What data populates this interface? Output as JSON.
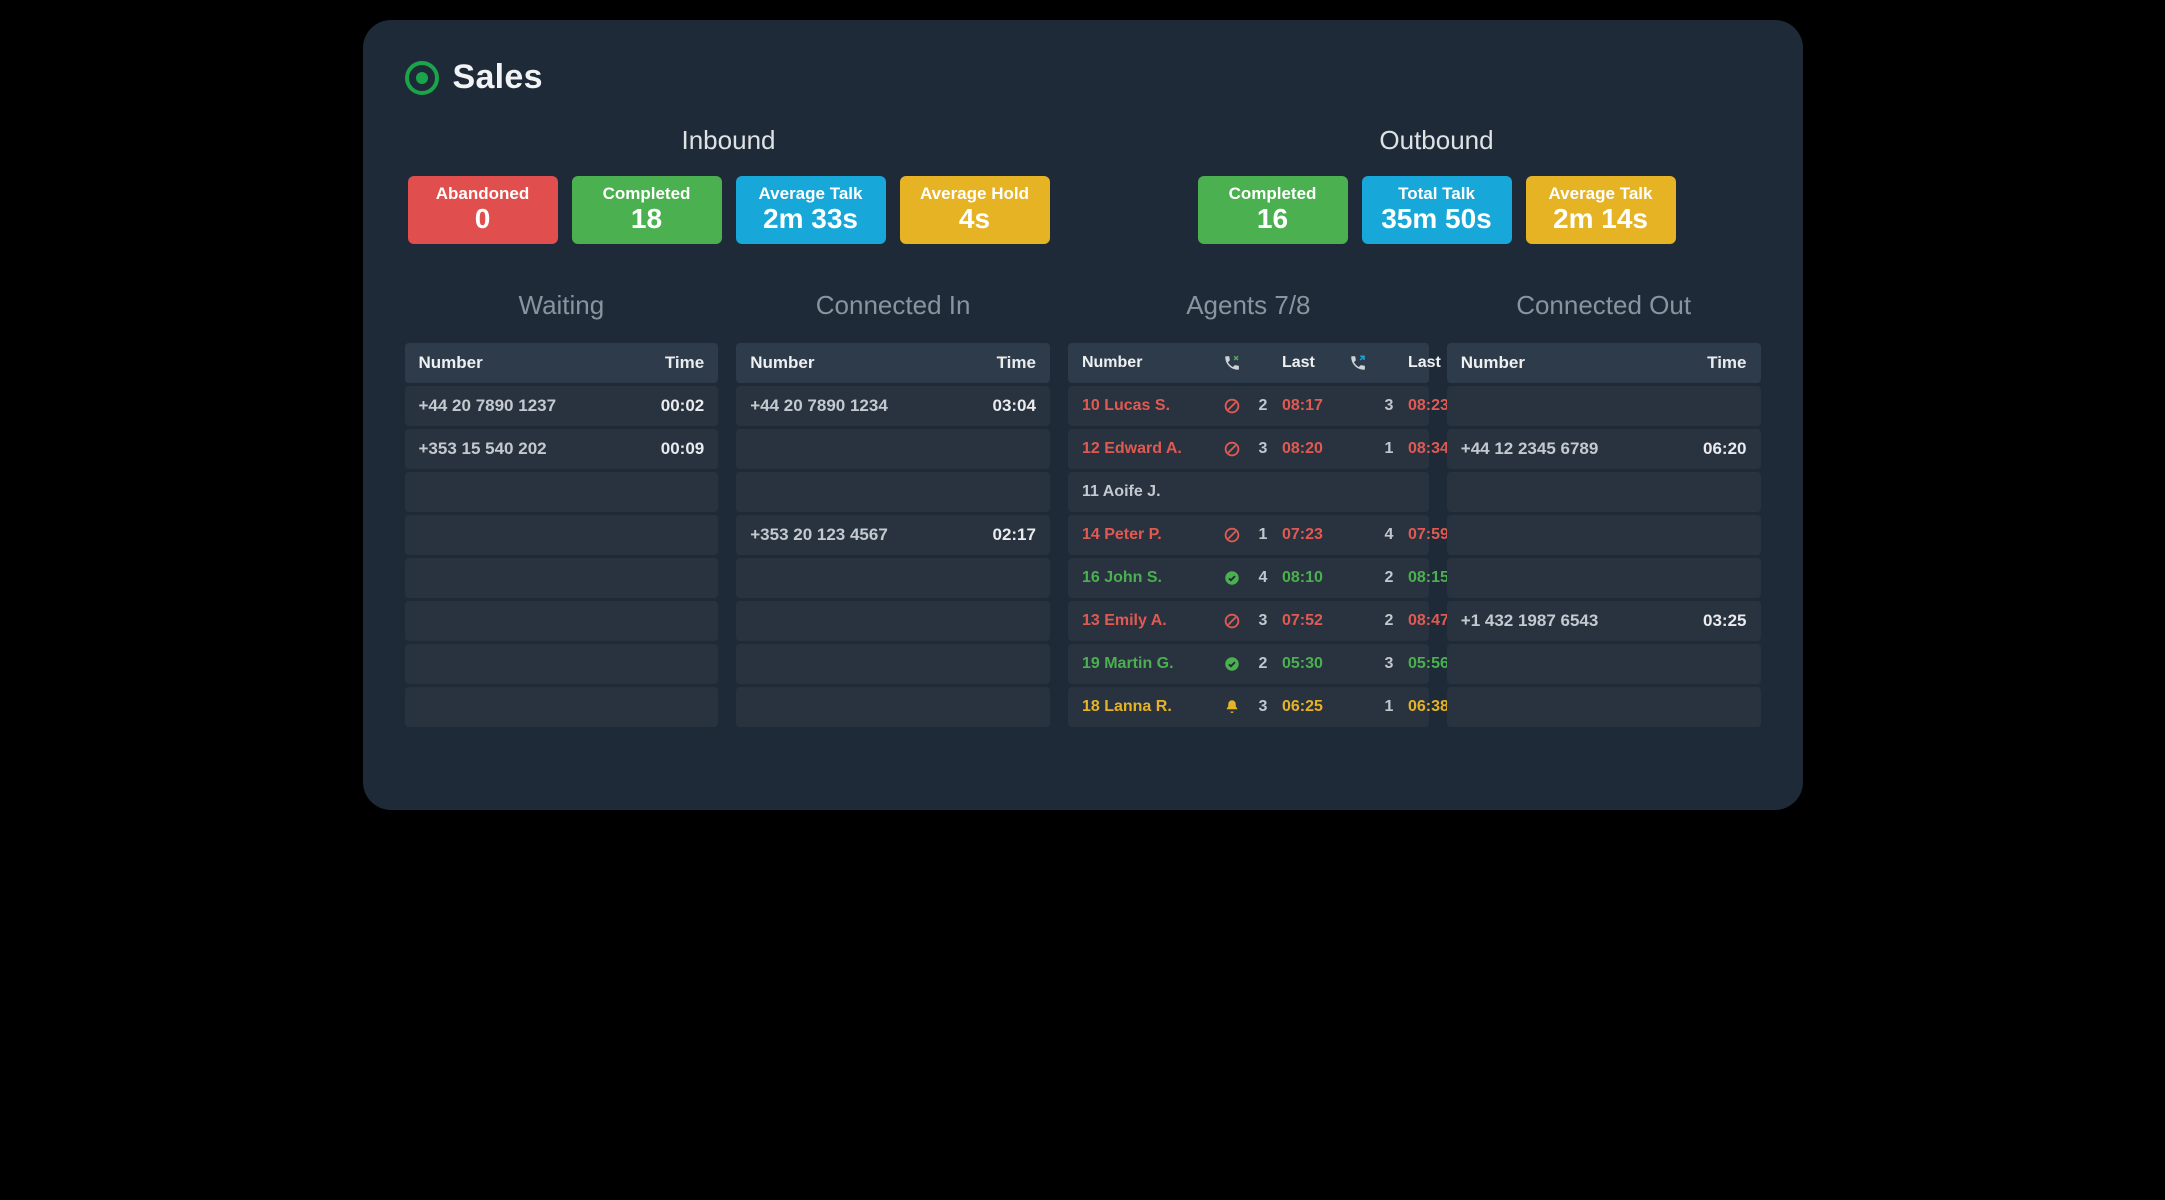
{
  "page": {
    "title": "Sales",
    "status": "online"
  },
  "metric_groups": [
    {
      "title": "Inbound",
      "cards": [
        {
          "label": "Abandoned",
          "value": "0",
          "color": "red"
        },
        {
          "label": "Completed",
          "value": "18",
          "color": "green"
        },
        {
          "label": "Average Talk",
          "value": "2m 33s",
          "color": "blue"
        },
        {
          "label": "Average Hold",
          "value": "4s",
          "color": "yellow"
        }
      ]
    },
    {
      "title": "Outbound",
      "cards": [
        {
          "label": "Completed",
          "value": "16",
          "color": "green"
        },
        {
          "label": "Total Talk",
          "value": "35m 50s",
          "color": "blue"
        },
        {
          "label": "Average Talk",
          "value": "2m 14s",
          "color": "yellow"
        }
      ]
    }
  ],
  "columns": {
    "waiting": {
      "title": "Waiting",
      "headers": {
        "number": "Number",
        "time": "Time"
      },
      "rows": [
        {
          "number": "+44 20 7890 1237",
          "time": "00:02"
        },
        {
          "number": "+353 15 540 202",
          "time": "00:09"
        },
        null,
        null,
        null,
        null,
        null,
        null
      ]
    },
    "connected_in": {
      "title": "Connected In",
      "headers": {
        "number": "Number",
        "time": "Time"
      },
      "rows": [
        {
          "number": "+44 20 7890 1234",
          "time": "03:04"
        },
        null,
        null,
        {
          "number": "+353 20 123 4567",
          "time": "02:17"
        },
        null,
        null,
        null,
        null
      ]
    },
    "agents": {
      "title": "Agents 7/8",
      "headers": {
        "number": "Number",
        "last1": "Last",
        "last2": "Last"
      },
      "rows": [
        {
          "name": "10 Lucas S.",
          "status": "blocked",
          "class": "red",
          "c1": "2",
          "t1": "08:17",
          "c2": "3",
          "t2": "08:23"
        },
        {
          "name": "12 Edward A.",
          "status": "blocked",
          "class": "red",
          "c1": "3",
          "t1": "08:20",
          "c2": "1",
          "t2": "08:34"
        },
        {
          "name": "11 Aoife J.",
          "status": "",
          "class": "grey",
          "c1": "",
          "t1": "",
          "c2": "",
          "t2": ""
        },
        {
          "name": "14 Peter P.",
          "status": "blocked",
          "class": "red",
          "c1": "1",
          "t1": "07:23",
          "c2": "4",
          "t2": "07:59"
        },
        {
          "name": "16 John S.",
          "status": "available",
          "class": "green",
          "c1": "4",
          "t1": "08:10",
          "c2": "2",
          "t2": "08:15"
        },
        {
          "name": "13 Emily A.",
          "status": "blocked",
          "class": "red",
          "c1": "3",
          "t1": "07:52",
          "c2": "2",
          "t2": "08:47"
        },
        {
          "name": "19 Martin G.",
          "status": "available",
          "class": "green",
          "c1": "2",
          "t1": "05:30",
          "c2": "3",
          "t2": "05:56"
        },
        {
          "name": "18 Lanna R.",
          "status": "alert",
          "class": "yellow",
          "c1": "3",
          "t1": "06:25",
          "c2": "1",
          "t2": "06:38"
        }
      ]
    },
    "connected_out": {
      "title": "Connected Out",
      "headers": {
        "number": "Number",
        "time": "Time"
      },
      "rows": [
        null,
        {
          "number": "+44 12 2345 6789",
          "time": "06:20"
        },
        null,
        null,
        null,
        {
          "number": "+1 432 1987 6543",
          "time": "03:25"
        },
        null,
        null
      ]
    }
  }
}
